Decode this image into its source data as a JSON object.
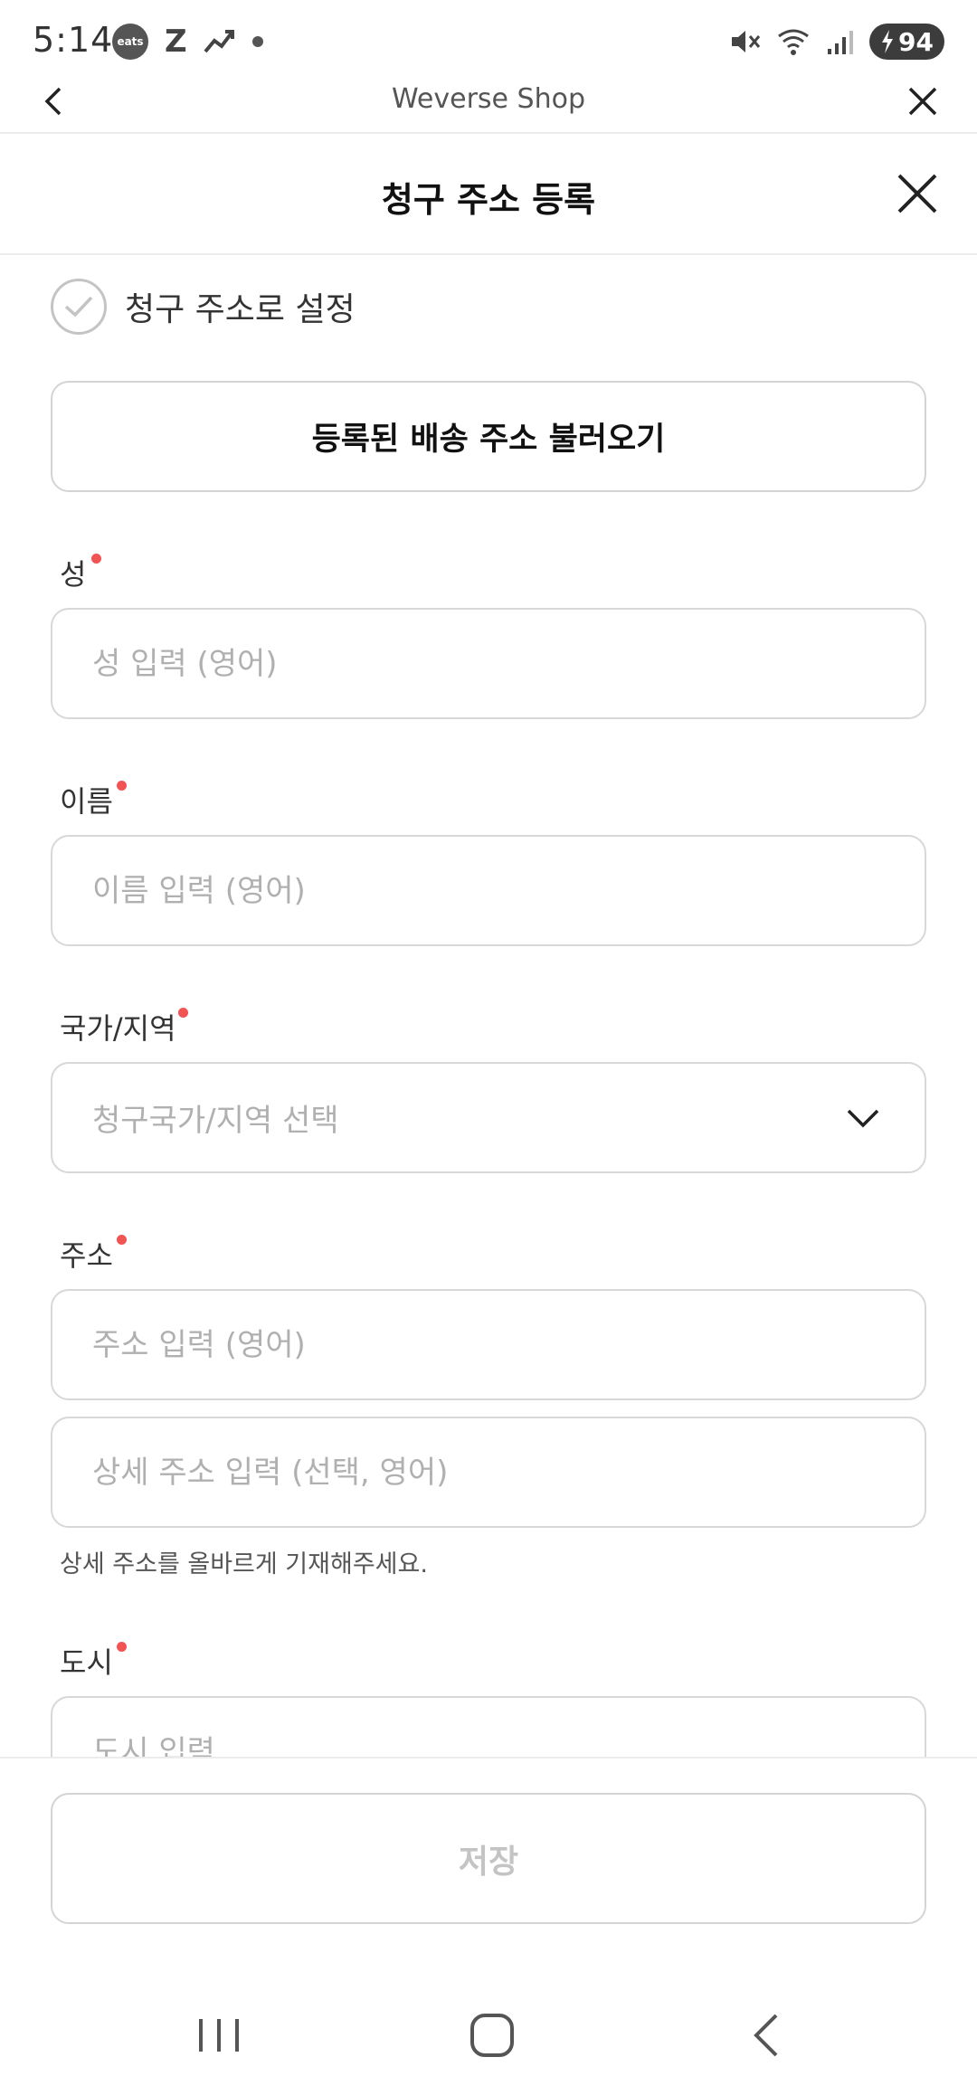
{
  "status_bar": {
    "time": "5:14",
    "eats_label": "eats",
    "z_label": "Z",
    "battery": "94"
  },
  "web_bar": {
    "title": "Weverse Shop"
  },
  "sheet": {
    "title": "청구 주소 등록"
  },
  "billing_checkbox": {
    "label": "청구 주소로 설정"
  },
  "load_button": {
    "label": "등록된 배송 주소 불러오기"
  },
  "fields": {
    "last_name": {
      "label": "성",
      "placeholder": "성 입력 (영어)"
    },
    "first_name": {
      "label": "이름",
      "placeholder": "이름 입력 (영어)"
    },
    "country": {
      "label": "국가/지역",
      "placeholder": "청구국가/지역 선택"
    },
    "address": {
      "label": "주소",
      "placeholder": "주소 입력 (영어)",
      "detail_placeholder": "상세 주소 입력 (선택, 영어)",
      "helper": "상세 주소를 올바르게 기재해주세요."
    },
    "city": {
      "label": "도시",
      "placeholder": "도시 입력"
    }
  },
  "save_button": {
    "label": "저장"
  },
  "colors": {
    "required_dot": "#f25353",
    "border": "#d8d8d8",
    "placeholder": "#b0b0b0",
    "disabled_text": "#c4c4c4"
  }
}
